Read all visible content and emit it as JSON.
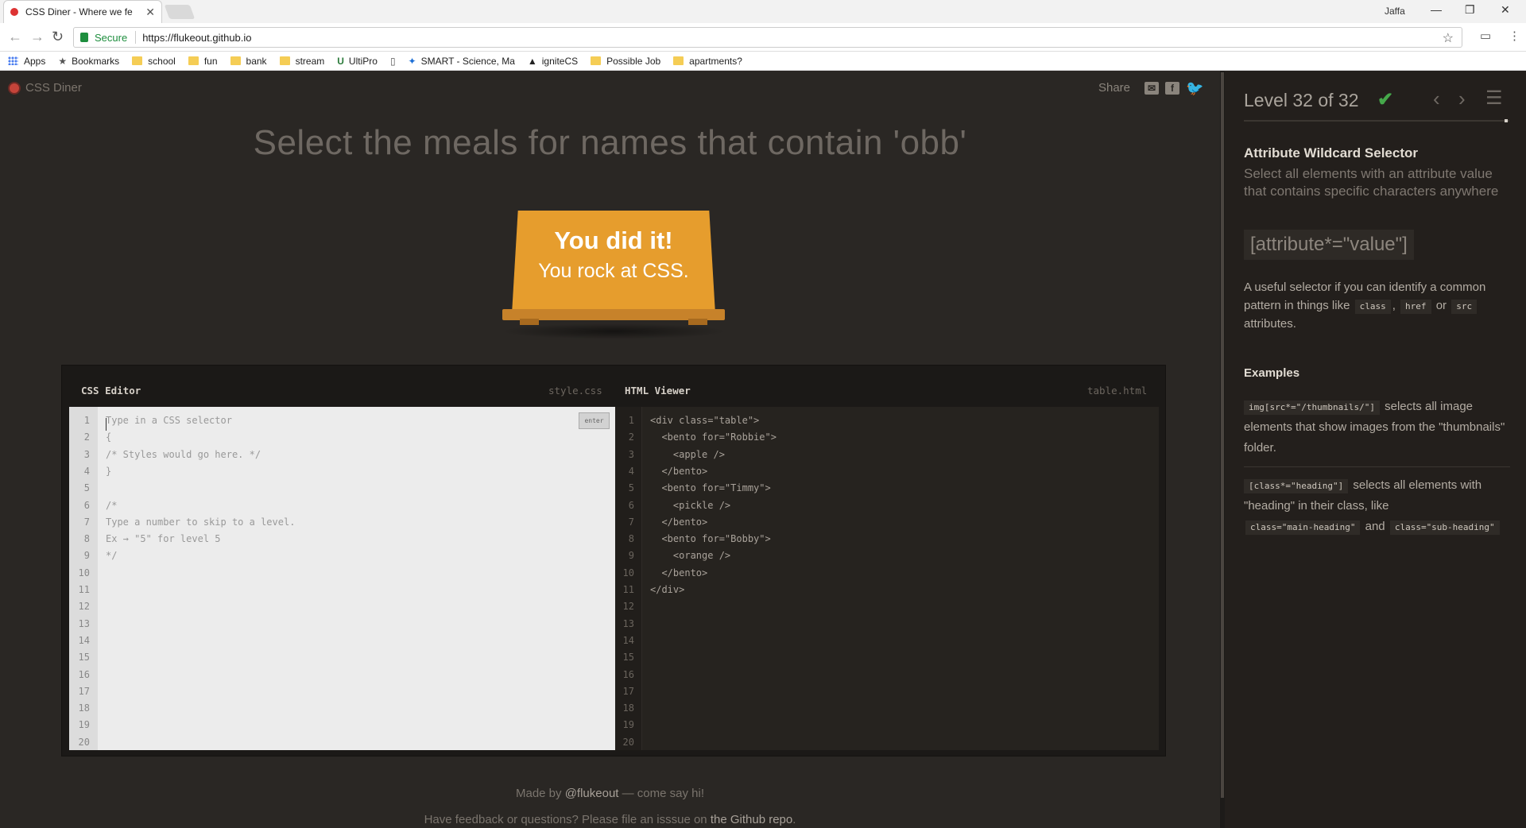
{
  "browser": {
    "tab_title": "CSS Diner - Where we fe",
    "tab_close": "✕",
    "profile": "Jaffa",
    "secure_label": "Secure",
    "url": "https://flukeout.github.io",
    "bookmarks": [
      {
        "label": "Apps",
        "icon": "apps-grid-icon"
      },
      {
        "label": "Bookmarks",
        "icon": "star-icon"
      },
      {
        "label": "school",
        "icon": "folder-icon"
      },
      {
        "label": "fun",
        "icon": "folder-icon"
      },
      {
        "label": "bank",
        "icon": "folder-icon"
      },
      {
        "label": "stream",
        "icon": "folder-icon"
      },
      {
        "label": "UltiPro",
        "icon": "ultipro-icon"
      },
      {
        "label": "",
        "icon": "page-icon"
      },
      {
        "label": "SMART - Science, Ma",
        "icon": "smart-icon"
      },
      {
        "label": "igniteCS",
        "icon": "graduation-cap-icon"
      },
      {
        "label": "Possible Job",
        "icon": "folder-icon"
      },
      {
        "label": "apartments?",
        "icon": "folder-icon"
      }
    ]
  },
  "game": {
    "logo": "CSS Diner",
    "share_label": "Share",
    "instruction": "Select the meals for names that contain 'obb'",
    "win_line1": "You did it!",
    "win_line2": "You rock at CSS.",
    "css_editor": {
      "title": "CSS Editor",
      "file": "style.css",
      "enter_label": "enter",
      "lines": [
        "Type in a CSS selector",
        "{",
        "/* Styles would go here. */",
        "}",
        "",
        "/*",
        "Type a number to skip to a level.",
        "Ex → \"5\" for level 5",
        "*/",
        "",
        "",
        "",
        "",
        "",
        "",
        "",
        "",
        "",
        "",
        ""
      ]
    },
    "html_viewer": {
      "title": "HTML Viewer",
      "file": "table.html",
      "lines": [
        "<div class=\"table\">",
        "  <bento for=\"Robbie\">",
        "    <apple />",
        "  </bento>",
        "  <bento for=\"Timmy\">",
        "    <pickle />",
        "  </bento>",
        "  <bento for=\"Bobby\">",
        "    <orange />",
        "  </bento>",
        "</div>",
        "",
        "",
        "",
        "",
        "",
        "",
        "",
        "",
        ""
      ]
    },
    "footer": {
      "made_by_pre": "Made by ",
      "made_by_handle": "@flukeout",
      "made_by_post": " — come say hi!",
      "feedback_pre": "Have feedback or questions? Please file an isssue on ",
      "feedback_link": "the Github repo",
      "feedback_post": "."
    }
  },
  "sidebar": {
    "level_title": "Level 32 of 32",
    "check": "✔",
    "selector_name": "Attribute Wildcard Selector",
    "selector_title": "Select all elements with an attribute value that contains specific characters anywhere",
    "syntax": "[attribute*=\"value\"]",
    "hint_pre": "A useful selector if you can identify a common pattern in things like ",
    "hint_tag1": "class",
    "hint_mid1": ", ",
    "hint_tag2": "href",
    "hint_mid2": " or ",
    "hint_tag3": "src",
    "hint_post": " attributes.",
    "examples_heading": "Examples",
    "example1_code": "img[src*=\"/thumbnails/\"]",
    "example1_text": " selects all image elements that show images from the \"thumbnails\" folder.",
    "example2_code": "[class*=\"heading\"]",
    "example2_text": " selects all elements with \"heading\" in their class, like ",
    "example2_code2": "class=\"main-heading\"",
    "example2_and": " and ",
    "example2_code3": "class=\"sub-heading\""
  },
  "colors": {
    "background": "#2a2724",
    "table_orange": "#e69d2d",
    "check_green": "#45a84a",
    "logo_red": "#c5443a"
  }
}
